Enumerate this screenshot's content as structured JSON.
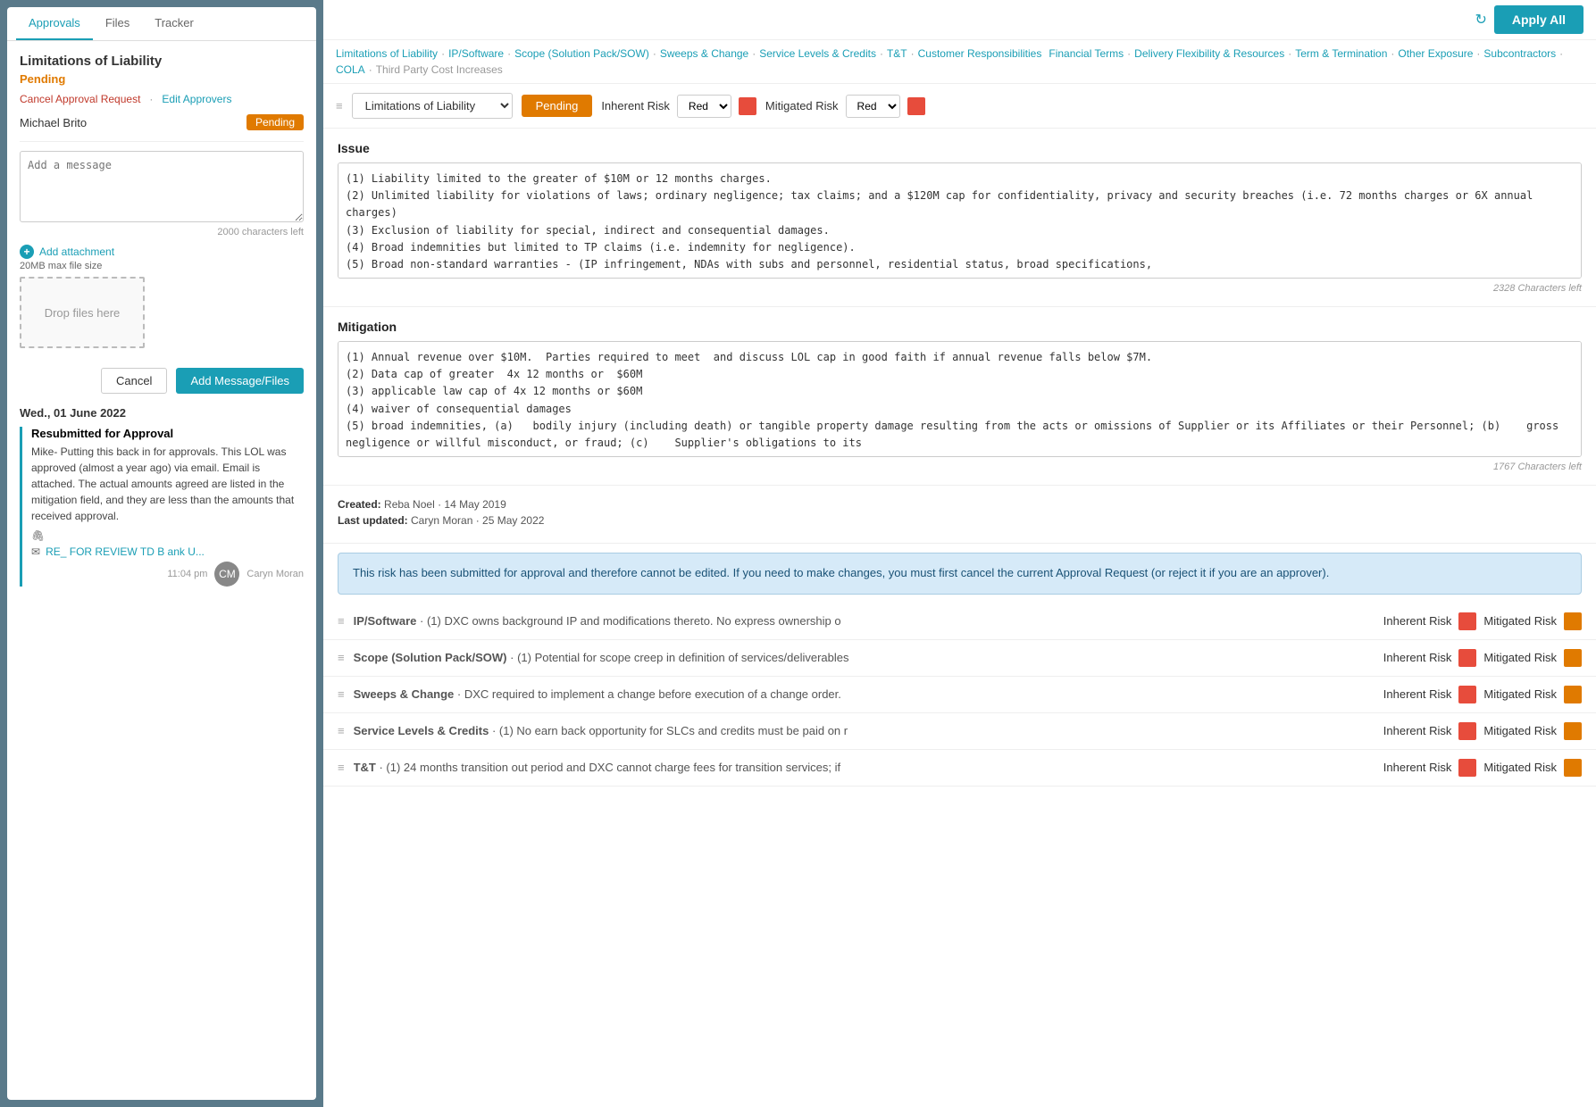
{
  "leftPanel": {
    "tabs": [
      "Approvals",
      "Files",
      "Tracker"
    ],
    "activeTab": "Approvals",
    "sectionTitle": "Limitations of Liability",
    "status": "Pending",
    "links": {
      "cancel": "Cancel Approval Request",
      "separator": "·",
      "edit": "Edit Approvers"
    },
    "approver": {
      "name": "Michael Brito",
      "badge": "Pending"
    },
    "messageArea": {
      "placeholder": "Add a message",
      "charsLeft": "2000 characters left"
    },
    "attachment": {
      "label": "Add attachment",
      "sizeNote": "20MB max file size",
      "dropLabel": "Drop files here"
    },
    "buttons": {
      "cancel": "Cancel",
      "submit": "Add Message/Files"
    },
    "timeline": {
      "date": "Wed., 01 June 2022",
      "message": {
        "title": "Resubmitted for Approval",
        "body": "Mike- Putting this back in for approvals.  This LOL was approved (almost a year ago) via email.  Email is attached.  The actual amounts agreed are listed in the mitigation field, and they are less than the amounts that received approval.",
        "attachmentIcon": "paperclip",
        "linkIcon": "envelope",
        "linkText": "RE_ FOR REVIEW TD B ank U...",
        "time": "11:04 pm",
        "author": "Caryn Moran"
      }
    }
  },
  "topBar": {
    "refreshIcon": "↻",
    "applyAllLabel": "Apply All"
  },
  "navLinks": [
    {
      "label": "Limitations of Liability",
      "active": true
    },
    {
      "label": "IP/Software",
      "active": true
    },
    {
      "label": "Scope (Solution Pack/SOW)",
      "active": true
    },
    {
      "label": "Sweeps & Change",
      "active": true
    },
    {
      "label": "Service Levels & Credits",
      "active": true
    },
    {
      "label": "T&T",
      "active": true
    },
    {
      "label": "Customer Responsibilities",
      "active": true
    },
    {
      "label": "Financial Terms",
      "active": true
    },
    {
      "label": "Delivery Flexibility & Resources",
      "active": true
    },
    {
      "label": "Term & Termination",
      "active": true
    },
    {
      "label": "Other Exposure",
      "active": true
    },
    {
      "label": "Subcontractors",
      "active": true
    },
    {
      "label": "COLA",
      "active": true
    },
    {
      "label": "Third Party Cost Increases",
      "active": false
    }
  ],
  "issueToolbar": {
    "dropdown": "Limitations of Liability",
    "statusBadge": "Pending",
    "inherentRiskLabel": "Inherent Risk",
    "inherentRiskValue": "Red",
    "mitigatedRiskLabel": "Mitigated Risk",
    "mitigatedRiskValue": "Red"
  },
  "issueSection": {
    "heading": "Issue",
    "text": "(1) Liability limited to the greater of $10M or 12 months charges.\n(2) Unlimited liability for violations of laws; ordinary negligence; tax claims; and a $120M cap for confidentiality, privacy and security breaches (i.e. 72 months charges or 6X annual charges)\n(3) Exclusion of liability for special, indirect and consequential damages.\n(4) Broad indemnities but limited to TP claims (i.e. indemnity for negligence).\n(5) Broad non-standard warranties - (IP infringement, NDAs with subs and personnel, residential status, broad specifications,",
    "charsLeft": "2328 Characters left"
  },
  "mitigationSection": {
    "heading": "Mitigation",
    "text": "(1) Annual revenue over $10M.  Parties required to meet  and discuss LOL cap in good faith if annual revenue falls below $7M.\n(2) Data cap of greater  4x 12 months or  $60M\n(3) applicable law cap of 4x 12 months or $60M\n(4) waiver of consequential damages\n(5) broad indemnities, (a)   bodily injury (including death) or tangible property damage resulting from the acts or omissions of Supplier or its Affiliates or their Personnel; (b)    gross negligence or willful misconduct, or fraud; (c)    Supplier's obligations to its",
    "charsLeft": "1767 Characters left"
  },
  "metaInfo": {
    "created": "Created:",
    "createdValue": "Reba Noel · 14 May 2019",
    "lastUpdated": "Last updated:",
    "lastUpdatedValue": "Caryn Moran · 25 May 2022"
  },
  "infoBanner": "This risk has been submitted for approval and therefore cannot be edited. If you need to make changes, you must first cancel the current Approval Request (or reject it if you are an approver).",
  "riskList": [
    {
      "title": "IP/Software",
      "desc": " · (1) DXC owns background IP and modifications thereto. No express ownership o",
      "inherentRisk": "red",
      "mitigatedRisk": "orange"
    },
    {
      "title": "Scope (Solution Pack/SOW)",
      "desc": " · (1) Potential for scope creep in definition of services/deliverables",
      "inherentRisk": "red",
      "mitigatedRisk": "orange"
    },
    {
      "title": "Sweeps & Change",
      "desc": " · DXC required to implement a change before execution of a change order.",
      "inherentRisk": "red",
      "mitigatedRisk": "orange"
    },
    {
      "title": "Service Levels & Credits",
      "desc": " · (1) No earn back opportunity for SLCs and credits must be paid on r",
      "inherentRisk": "red",
      "mitigatedRisk": "orange"
    },
    {
      "title": "T&T",
      "desc": " · (1) 24 months transition out period and DXC cannot charge fees for transition services; if",
      "inherentRisk": "red",
      "mitigatedRisk": "orange"
    }
  ]
}
